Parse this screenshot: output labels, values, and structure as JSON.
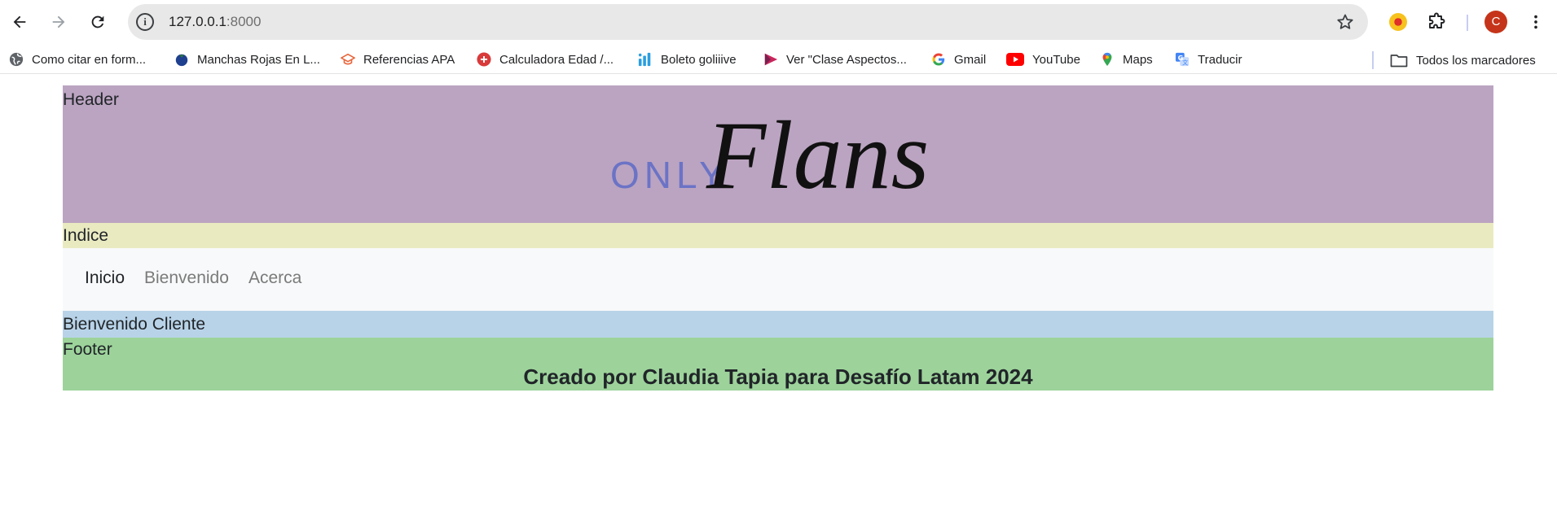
{
  "browser": {
    "url_host": "127.0.0.1",
    "url_port": ":8000",
    "profile_initial": "C",
    "bookmarks": [
      {
        "label": "Como citar en form...",
        "icon": "globe-icon"
      },
      {
        "label": "Manchas Rojas En L...",
        "icon": "blueberry-icon"
      },
      {
        "label": "Referencias APA",
        "icon": "graduation-cap-icon"
      },
      {
        "label": "Calculadora Edad /...",
        "icon": "calculator-icon"
      },
      {
        "label": "Boleto goliiive",
        "icon": "bars-icon"
      },
      {
        "label": "Ver \"Clase Aspectos...",
        "icon": "play-icon"
      },
      {
        "label": "Gmail",
        "icon": "google-icon"
      },
      {
        "label": "YouTube",
        "icon": "youtube-icon"
      },
      {
        "label": "Maps",
        "icon": "maps-pin-icon"
      },
      {
        "label": "Traducir",
        "icon": "translate-icon"
      }
    ],
    "all_bookmarks_label": "Todos los marcadores"
  },
  "page": {
    "header_label": "Header",
    "logo": {
      "prefix": "ONLY",
      "script": "Flans"
    },
    "index_label": "Indice",
    "nav": [
      {
        "label": "Inicio",
        "active": true
      },
      {
        "label": "Bienvenido",
        "active": false
      },
      {
        "label": "Acerca",
        "active": false
      }
    ],
    "welcome_text": "Bienvenido Cliente",
    "footer_label": "Footer",
    "credit": "Creado por Claudia Tapia para Desafío Latam 2024"
  },
  "colors": {
    "header_bg": "#bba4c1",
    "index_bg": "#eaeac1",
    "nav_bg": "#f8f9fa",
    "welcome_bg": "#b8d3e8",
    "footer_bg": "#9dd39b",
    "logo_prefix": "#6b73c6"
  }
}
